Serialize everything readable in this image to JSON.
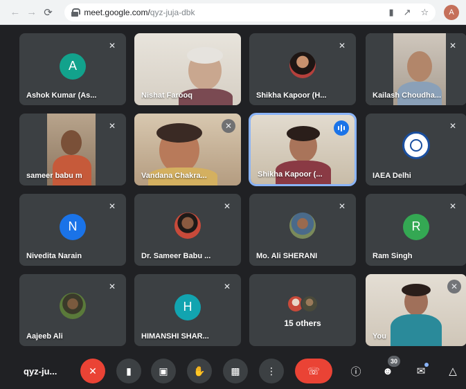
{
  "browser": {
    "url_host": "meet.google.com/",
    "url_path": "qyz-juja-dbk",
    "profile_initial": "A"
  },
  "tiles": [
    {
      "name": "Ashok Kumar (As...",
      "initial": "A",
      "color": "#12a28c"
    },
    {
      "name": "Nishat Farooq"
    },
    {
      "name": "Shikha Kapoor (H..."
    },
    {
      "name": "Kailash Choudha..."
    },
    {
      "name": "sameer babu m"
    },
    {
      "name": "Vandana Chakra..."
    },
    {
      "name": "Shikha Kapoor (..."
    },
    {
      "name": "IAEA Delhi"
    },
    {
      "name": "Nivedita Narain",
      "initial": "N",
      "color": "#1a73e8"
    },
    {
      "name": "Dr. Sameer Babu ..."
    },
    {
      "name": "Mo. Ali SHERANI"
    },
    {
      "name": "Ram Singh",
      "initial": "R",
      "color": "#34a853"
    },
    {
      "name": "Aajeeb Ali"
    },
    {
      "name": "HIMANSHI SHAR...",
      "initial": "H",
      "color": "#12a4b0"
    },
    {
      "name": "15 others"
    },
    {
      "name": "You"
    }
  ],
  "bottom_bar": {
    "meeting_code": "qyz-ju...",
    "participant_count": "30"
  },
  "colors": {
    "background": "#202124",
    "tile": "#3c4043",
    "hangup": "#ea4335",
    "active_speaker": "#8ab4f8"
  }
}
